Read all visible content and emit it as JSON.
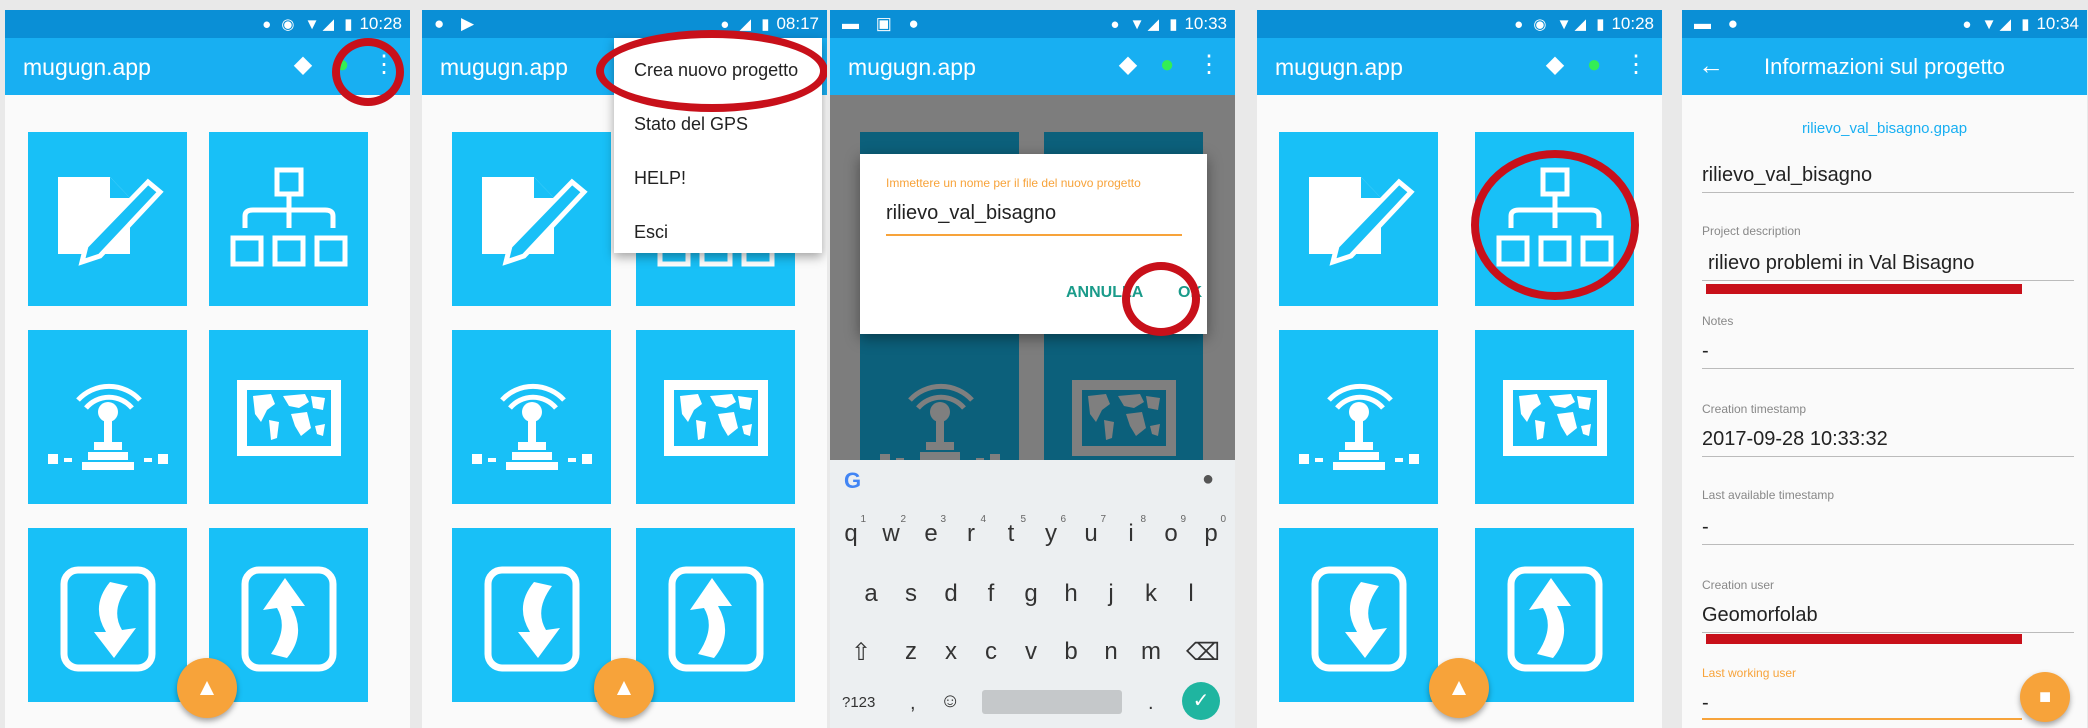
{
  "status": {
    "p1_time": "10:28",
    "p2_time": "08:17",
    "p3_time": "10:33",
    "p4_time": "10:28",
    "p5_time": "10:34"
  },
  "app": {
    "title": "mugugn.app"
  },
  "menu": {
    "items": [
      "Crea nuovo progetto",
      "Stato del GPS",
      "HELP!",
      "Esci"
    ]
  },
  "dialog": {
    "prompt": "Immettere un nome per il file del nuovo progetto",
    "value": "rilievo_val_bisagno",
    "cancel_label": "ANNULLA",
    "ok_label": "OK"
  },
  "keyboard": {
    "row1": [
      "q",
      "w",
      "e",
      "r",
      "t",
      "y",
      "u",
      "i",
      "o",
      "p"
    ],
    "row1_digits": [
      "1",
      "2",
      "3",
      "4",
      "5",
      "6",
      "7",
      "8",
      "9",
      "0"
    ],
    "row2": [
      "a",
      "s",
      "d",
      "f",
      "g",
      "h",
      "j",
      "k",
      "l"
    ],
    "row3": [
      "z",
      "x",
      "c",
      "v",
      "b",
      "n",
      "m"
    ],
    "mode_key": "?123",
    "comma": ",",
    "period": "."
  },
  "project_info": {
    "title": "Informazioni sul progetto",
    "filename": "rilievo_val_bisagno.gpap",
    "name": "rilievo_val_bisagno",
    "description_label": "Project description",
    "description": "rilievo problemi in Val Bisagno",
    "notes_label": "Notes",
    "notes": "-",
    "creation_ts_label": "Creation timestamp",
    "creation_ts": "2017-09-28 10:33:32",
    "last_ts_label": "Last available timestamp",
    "last_ts": "-",
    "creation_user_label": "Creation user",
    "creation_user": "Geomorfolab",
    "last_user_label": "Last working user",
    "last_user": "-"
  },
  "icons": {
    "layers": "layers-icon",
    "gps": "gps-status-icon",
    "overflow": "more-vert-icon",
    "notes": "notes-icon",
    "project": "project-tree-icon",
    "gps_log": "gps-log-icon",
    "map": "map-icon",
    "import": "import-icon",
    "export": "export-icon",
    "alert": "warning-icon",
    "save": "save-icon"
  },
  "colors": {
    "appbar": "#18aff2",
    "statusbar": "#0a8fd6",
    "tile": "#18c0f7",
    "accent": "#f7a33a",
    "highlight": "#c8101a",
    "dialog_button": "#1a9b8a"
  }
}
